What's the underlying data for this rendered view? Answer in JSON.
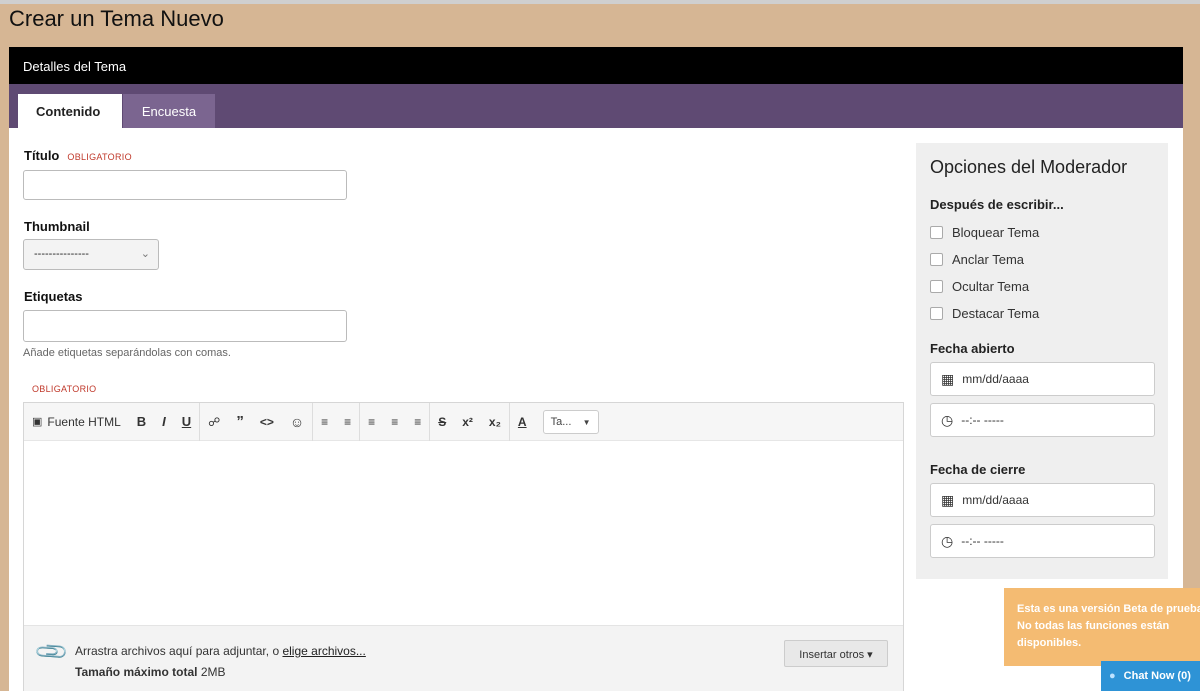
{
  "page_title": "Crear un Tema Nuevo",
  "panel_header": "Detalles del Tema",
  "tabs": [
    {
      "label": "Contenido",
      "active": true
    },
    {
      "label": "Encuesta",
      "active": false
    }
  ],
  "form": {
    "title_label": "Título",
    "required_tag": "OBLIGATORIO",
    "thumbnail_label": "Thumbnail",
    "thumbnail_value": "---------------",
    "tags_label": "Etiquetas",
    "tags_hint": "Añade etiquetas separándolas con comas.",
    "content_required_tag": "OBLIGATORIO"
  },
  "editor": {
    "source_label": "Fuente HTML",
    "bold": "B",
    "italic": "I",
    "underline": "U",
    "size_select": "Ta...",
    "attach_text": "Arrastra archivos aquí para adjuntar, o",
    "attach_link": "elige archivos...",
    "max_size_label": "Tamaño máximo total",
    "max_size_value": "2MB",
    "insert_other": "Insertar otros ▾"
  },
  "moderator": {
    "title": "Opciones del Moderador",
    "after_label": "Después de escribir...",
    "options": [
      "Bloquear Tema",
      "Anclar Tema",
      "Ocultar Tema",
      "Destacar Tema"
    ],
    "open_date_label": "Fecha abierto",
    "close_date_label": "Fecha de cierre",
    "date_placeholder": "mm/dd/aaaa",
    "time_placeholder": "--:-- -----"
  },
  "beta_notice": [
    "Esta es una versión Beta de prueba.",
    "No todas las funciones están",
    "disponibles."
  ],
  "chat": {
    "label": "Chat Now (0)"
  },
  "colors": {
    "tab_bar": "#5f4a73",
    "header": "#000000",
    "beta": "#f4bb72",
    "chat": "#2e93d6"
  }
}
